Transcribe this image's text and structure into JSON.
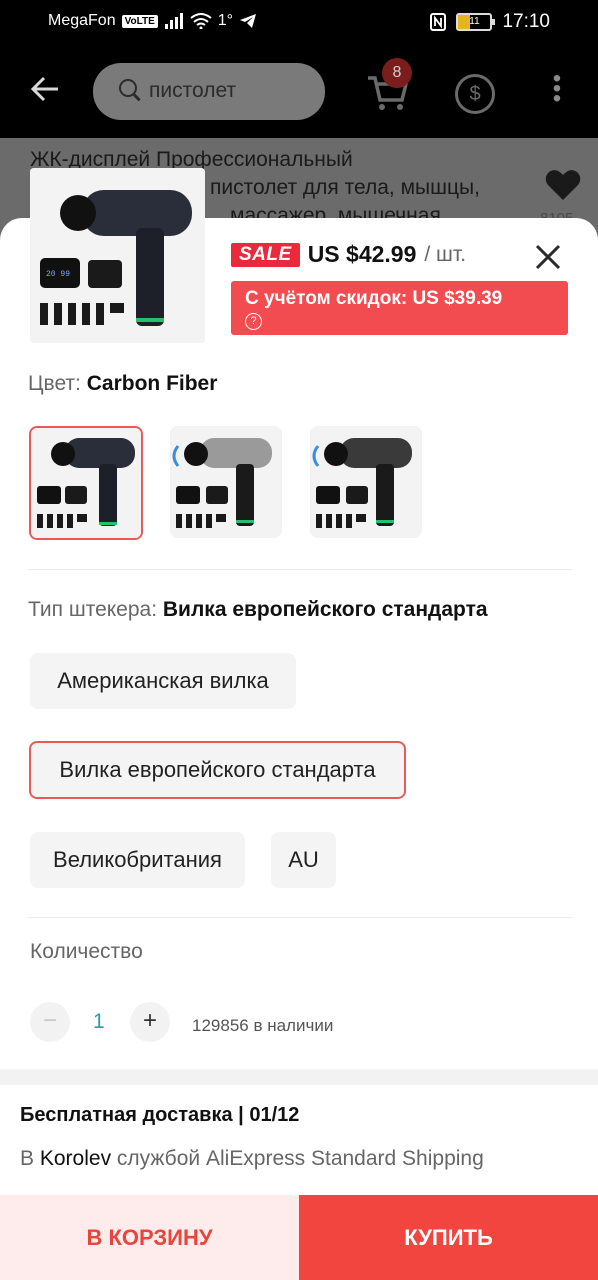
{
  "status": {
    "carrier": "MegaFon",
    "volte": "VoLTE",
    "extra": "1°",
    "battery": "11",
    "time": "17:10"
  },
  "appbar": {
    "search_text": "пистолет",
    "cart_count": "8"
  },
  "background": {
    "title": "ЖК-дисплей Профессиональный пистолет для тела, мышцы, массажер, мышечная",
    "title_line1": "ЖК-дисплей Профессиональный",
    "title_line2": "пистолет для тела, мышцы,",
    "title_line3": "массажер, мышечная",
    "count": "8105"
  },
  "product": {
    "sale_badge": "SALE",
    "price": "US $42.99",
    "unit": "/ шт.",
    "discount_text": "С учётом скидок: US $39.39",
    "help_icon_text": "?"
  },
  "color": {
    "label": "Цвет:",
    "selected": "Carbon Fiber",
    "swatches": [
      {
        "name": "Carbon Fiber",
        "body": "#2a2e3a"
      },
      {
        "name": "Silver",
        "body": "#9a9a9a"
      },
      {
        "name": "Black",
        "body": "#3a3a3a"
      }
    ]
  },
  "plug": {
    "label": "Тип штекера:",
    "selected": "Вилка европейского стандарта",
    "options": [
      "Американская вилка",
      "Вилка европейского стандарта",
      "Великобритания",
      "AU"
    ]
  },
  "quantity": {
    "label": "Количество",
    "minus": "−",
    "value": "1",
    "plus": "+",
    "stock": "129856 в наличии"
  },
  "shipping": {
    "title": "Бесплатная доставка | 01/12",
    "prefix": "В",
    "city": "Korolev",
    "suffix": "службой AliExpress Standard Shipping"
  },
  "actions": {
    "add_to_cart": "В КОРЗИНУ",
    "buy": "КУПИТЬ"
  },
  "colors": {
    "accent": "#f24540",
    "sale": "#ea2a3c",
    "selected_border": "#e85a5a",
    "qty_value": "#2b9ca8"
  }
}
